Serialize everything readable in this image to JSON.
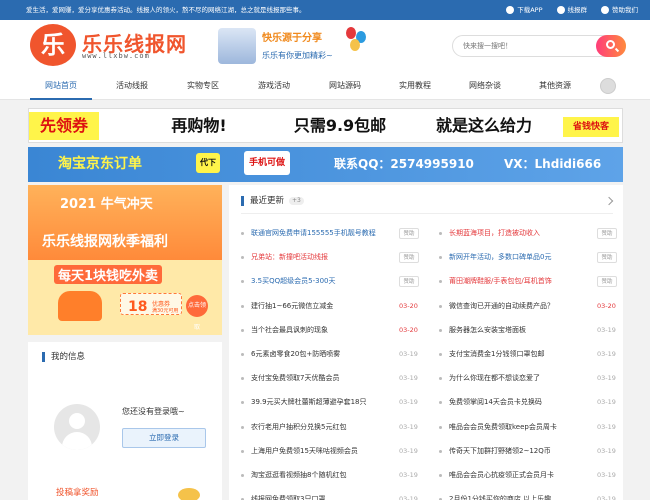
{
  "topbar": {
    "notice": "爱生活，爱网赚，爱分享优惠券活动。线报人的领火，熬不尽的网络江湖，总之就是线报那些事。",
    "links": [
      "下载APP",
      "线报群",
      "赞助我们"
    ]
  },
  "header": {
    "logo_char": "乐",
    "logo_text": "乐乐线报网",
    "logo_domain": "www.llxbw.com",
    "slogan_top": "快乐源于分享",
    "slogan_bottom": "乐乐有你更加精彩~",
    "search_placeholder": "快来搜一搜吧！"
  },
  "nav": {
    "items": [
      "网站首页",
      "活动线报",
      "实物专区",
      "游戏活动",
      "网站源码",
      "实用教程",
      "网络杂谈",
      "其他资源"
    ],
    "active_index": 0
  },
  "banners": {
    "b1": [
      "先领券",
      "再购物!",
      "只需9.9包邮",
      "就是这么给力",
      "省钱快客"
    ],
    "b2": [
      "淘宝京东订单",
      "代下",
      "手机可做",
      "联系QQ：2574995910",
      "VX：Lhdidi666"
    ]
  },
  "promo": {
    "line1": "2021 牛气冲天",
    "line2": "乐乐线报网秋季福利",
    "line3": "每天1块钱吃外卖",
    "coupon_value": "18",
    "coupon_label": "优惠券",
    "coupon_note": "满30元可用",
    "claim": "点击领取"
  },
  "myinfo": {
    "title": "我的信息",
    "not_logged": "您还没有登录哦~",
    "login_button": "立即登录",
    "reward": "投稿拿奖励"
  },
  "latest": {
    "title": "最近更新",
    "count": "+3",
    "left": [
      {
        "title": "联通官网免费申请155555手机靓号教程",
        "tag": "赞助",
        "date": "",
        "color": "#2b6bb0"
      },
      {
        "title": "兄弟站：新撞吧活动线报",
        "tag": "赞助",
        "date": "",
        "color": "#e4393c"
      },
      {
        "title": "3.5买QQ超级会员5-300天",
        "tag": "赞助",
        "date": "",
        "color": "#2b6bb0"
      },
      {
        "title": "建行抽1~66元微信立减金",
        "tag": "",
        "date": "03-20",
        "color": "#333333"
      },
      {
        "title": "当个社会最具讽刺的现象",
        "tag": "",
        "date": "03-20",
        "color": "#333333"
      },
      {
        "title": "6元素卤零食20包+防晒喷雾",
        "tag": "",
        "date": "03-19",
        "color": "#333333"
      },
      {
        "title": "支付宝免费领取7天优酷会员",
        "tag": "",
        "date": "03-19",
        "color": "#333333"
      },
      {
        "title": "39.9元买大牌杜蕾斯超薄避孕套18只",
        "tag": "",
        "date": "03-19",
        "color": "#333333"
      },
      {
        "title": "农行老用户抽积分兑换5元红包",
        "tag": "",
        "date": "03-19",
        "color": "#333333"
      },
      {
        "title": "上海用户免费领15天咪咕视频会员",
        "tag": "",
        "date": "03-19",
        "color": "#333333"
      },
      {
        "title": "淘宝逛逛看视频抽8个随机红包",
        "tag": "",
        "date": "03-19",
        "color": "#333333"
      },
      {
        "title": "线报网免费领取3只口罩",
        "tag": "",
        "date": "03-19",
        "color": "#333333"
      }
    ],
    "right": [
      {
        "title": "长期蓝海项目，打造被动收入",
        "tag": "赞助",
        "date": "",
        "color": "#e4393c"
      },
      {
        "title": "新网开年活动，多数口碑单品0元",
        "tag": "赞助",
        "date": "",
        "color": "#2b6bb0"
      },
      {
        "title": "莆田潮牌鞋服/手表包包/耳机首饰",
        "tag": "赞助",
        "date": "",
        "color": "#e4393c"
      },
      {
        "title": "微信查询已开通的自动续费产品？",
        "tag": "",
        "date": "03-20",
        "color": "#333333"
      },
      {
        "title": "服务器怎么安装宝塔面板",
        "tag": "",
        "date": "03-19",
        "color": "#333333"
      },
      {
        "title": "支付宝消费金1分钱领口罩包邮",
        "tag": "",
        "date": "03-19",
        "color": "#333333"
      },
      {
        "title": "为什么你现在都不想谈恋爱了",
        "tag": "",
        "date": "03-19",
        "color": "#333333"
      },
      {
        "title": "免费领掌阅14天会员卡兑换码",
        "tag": "",
        "date": "03-19",
        "color": "#333333"
      },
      {
        "title": "唯品会会员免费领取keep会员周卡",
        "tag": "",
        "date": "03-19",
        "color": "#333333"
      },
      {
        "title": "传奇天下加群打野猪领2~12Q币",
        "tag": "",
        "date": "03-19",
        "color": "#333333"
      },
      {
        "title": "唯品会会员心抗疫领正式会员月卡",
        "tag": "",
        "date": "03-19",
        "color": "#333333"
      },
      {
        "title": "2月份1分钱买你的商店 以上乐趣",
        "tag": "",
        "date": "03-19",
        "color": "#333333"
      }
    ]
  },
  "colors": {
    "brand": "#2b6bb0",
    "accent": "#f0552d",
    "hot": "#e4393c"
  }
}
